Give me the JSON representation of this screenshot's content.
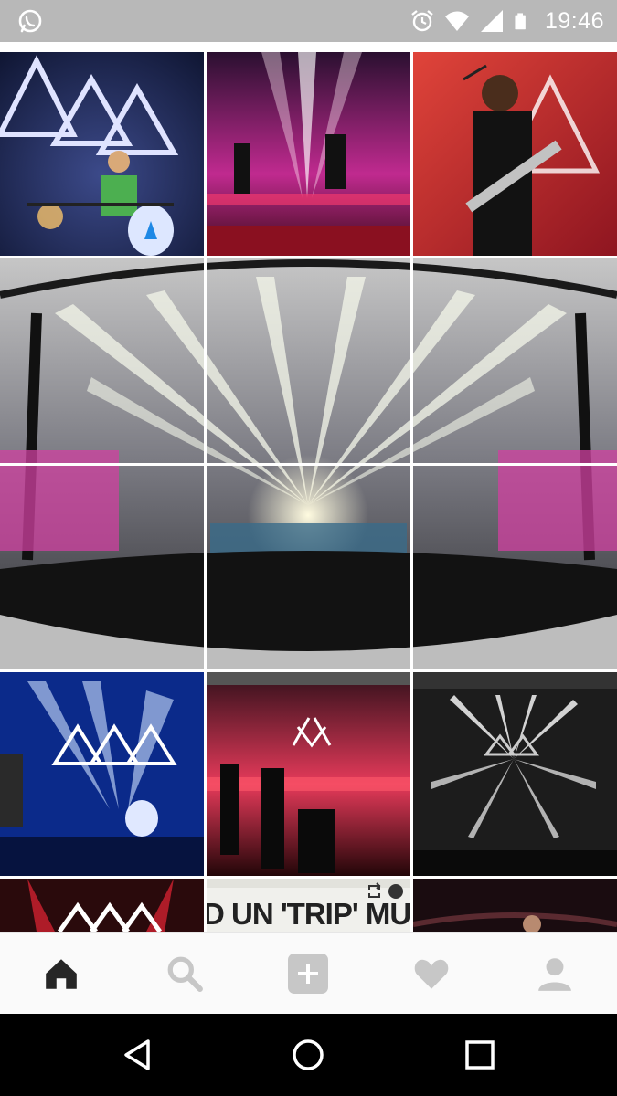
{
  "status_bar": {
    "time": "19:46",
    "left_icon": "whatsapp-icon",
    "right_icons": [
      "alarm-icon",
      "wifi-icon",
      "cell-signal-icon",
      "battery-icon"
    ],
    "background": "#b8b8b8"
  },
  "feed": {
    "tiles": [
      {
        "id": "post-1",
        "description_icon": "photo"
      },
      {
        "id": "post-2",
        "description_icon": "photo"
      },
      {
        "id": "post-3",
        "description_icon": "photo"
      },
      {
        "id": "post-4-panorama",
        "description_icon": "photo"
      },
      {
        "id": "post-5",
        "description_icon": "photo"
      },
      {
        "id": "post-6",
        "description_icon": "photo"
      },
      {
        "id": "post-7",
        "description_icon": "photo"
      },
      {
        "id": "post-8",
        "description_icon": "photo"
      },
      {
        "id": "post-9",
        "description_icon": "photo"
      },
      {
        "id": "post-10",
        "description_icon": "photo"
      }
    ],
    "partial_text": "D UN 'TRIP' MUSI",
    "partial_badge_icons": [
      "repost-icon",
      "avatar-icon"
    ]
  },
  "bottom_nav": {
    "items": [
      {
        "name": "home",
        "icon": "home-icon",
        "active": true
      },
      {
        "name": "search",
        "icon": "search-icon",
        "active": false
      },
      {
        "name": "add",
        "icon": "add-icon",
        "active": false
      },
      {
        "name": "activity",
        "icon": "heart-icon",
        "active": false
      },
      {
        "name": "profile",
        "icon": "profile-icon",
        "active": false
      }
    ],
    "active_color": "#262626",
    "inactive_color": "#c7c7c7"
  },
  "system_nav": {
    "items": [
      "back-icon",
      "home-circle-icon",
      "recents-icon"
    ]
  }
}
